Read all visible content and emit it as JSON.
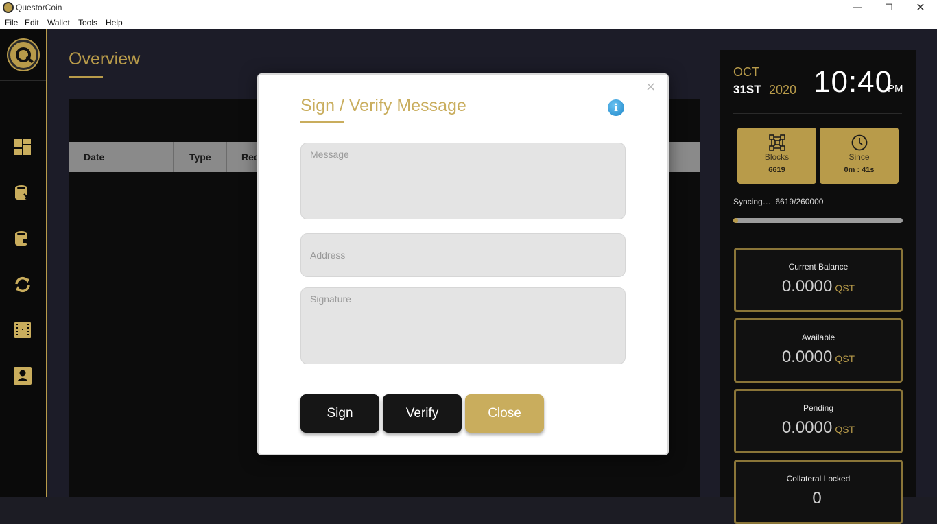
{
  "window": {
    "title": "QuestorCoin",
    "minimize": "—",
    "maximize": "❐",
    "close": "✕"
  },
  "menu": [
    "File",
    "Edit",
    "Wallet",
    "Tools",
    "Help"
  ],
  "sidebar": {
    "icons": [
      "dashboard-icon",
      "send-coins-icon",
      "receive-coins-icon",
      "sync-icon",
      "transactions-icon",
      "contacts-icon"
    ]
  },
  "overview": {
    "title": "Overview",
    "columns": [
      "Date",
      "Type",
      "Rec"
    ]
  },
  "clock": {
    "month": "OCT",
    "day": "31ST",
    "year": "2020",
    "time": "10:40",
    "ampm": "PM"
  },
  "stats": {
    "blocks_label": "Blocks",
    "blocks_value": "6619",
    "since_label": "Since",
    "since_value": "0m : 41s"
  },
  "sync": {
    "label": "Syncing…",
    "progress": "6619/260000",
    "fraction": 0.0255
  },
  "balances": [
    {
      "label": "Current Balance",
      "value": "0.0000",
      "unit": "QST"
    },
    {
      "label": "Available",
      "value": "0.0000",
      "unit": "QST"
    },
    {
      "label": "Pending",
      "value": "0.0000",
      "unit": "QST"
    },
    {
      "label": "Collateral Locked",
      "value": "0",
      "unit": ""
    }
  ],
  "modal": {
    "title": "Sign / Verify Message",
    "close_glyph": "×",
    "info_glyph": "i",
    "message_placeholder": "Message",
    "address_placeholder": "Address",
    "signature_placeholder": "Signature",
    "sign_label": "Sign",
    "verify_label": "Verify",
    "close_label": "Close"
  },
  "colors": {
    "accent_gold": "#b89b4a",
    "button_dark": "#161616",
    "button_gold": "#c9ad5d",
    "info_blue": "#1f87c9"
  }
}
